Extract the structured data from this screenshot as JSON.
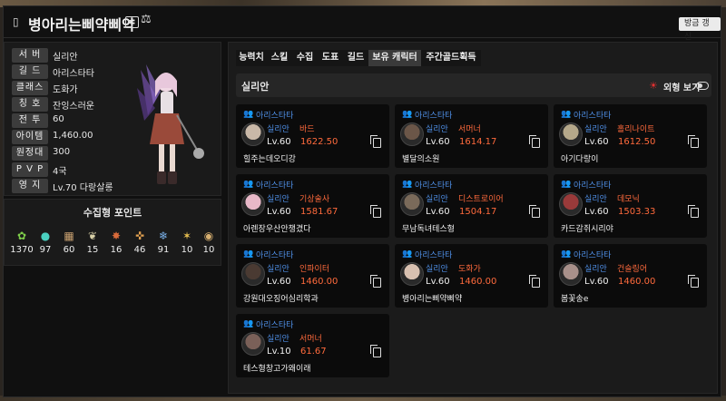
{
  "header": {
    "title": "병아리는삐약삐약",
    "refresh_label": "방금 갱신"
  },
  "profile": {
    "rows": [
      {
        "key": "서 버",
        "value": "실리안"
      },
      {
        "key": "길 드",
        "value": "아리스타타"
      },
      {
        "key": "클래스",
        "value": "도화가"
      },
      {
        "key": "칭 호",
        "value": "잔잉스러운"
      },
      {
        "key": "전 투",
        "value": "60"
      },
      {
        "key": "아이템",
        "value": "1,460.00"
      },
      {
        "key": "원정대",
        "value": "300"
      },
      {
        "key": "P V P",
        "value": "4국"
      },
      {
        "key": "영 지",
        "value": "Lv.70 다랑살롱"
      }
    ]
  },
  "collectibles": {
    "title": "수집형 포인트",
    "items": [
      {
        "icon": "mokoko-seed-icon",
        "value": "1370"
      },
      {
        "icon": "island-heart-icon",
        "value": "97"
      },
      {
        "icon": "great-art-icon",
        "value": "60"
      },
      {
        "icon": "giant-heart-icon",
        "value": "15"
      },
      {
        "icon": "ignea-token-icon",
        "value": "16"
      },
      {
        "icon": "sea-bounty-icon",
        "value": "46"
      },
      {
        "icon": "world-tree-leaf-icon",
        "value": "91"
      },
      {
        "icon": "orpheus-star-icon",
        "value": "10"
      },
      {
        "icon": "masterpiece-icon",
        "value": "10"
      }
    ]
  },
  "tabs": [
    {
      "label": "능력치"
    },
    {
      "label": "스킬"
    },
    {
      "label": "수집"
    },
    {
      "label": "도표"
    },
    {
      "label": "길드"
    },
    {
      "label": "보유 캐릭터"
    },
    {
      "label": "주간골드획득"
    }
  ],
  "active_tab": "보유 캐릭터",
  "roster": {
    "server": "실리안",
    "appearance_label": "외형 보기",
    "characters": [
      {
        "guild": "아리스타타",
        "server": "실리안",
        "class": "바드",
        "level": "Lv.60",
        "item_level": "1622.50",
        "name": "힐주는데오디강",
        "tone": "#c9b8a8"
      },
      {
        "guild": "아리스타타",
        "server": "실리안",
        "class": "서머너",
        "level": "Lv.60",
        "item_level": "1614.17",
        "name": "별달의소원",
        "tone": "#6b5648"
      },
      {
        "guild": "아리스타타",
        "server": "실리안",
        "class": "홀리나이트",
        "level": "Lv.60",
        "item_level": "1612.50",
        "name": "아기다랑이",
        "tone": "#b5a88a"
      },
      {
        "guild": "아리스타타",
        "server": "실리안",
        "class": "기상술사",
        "level": "Lv.60",
        "item_level": "1581.67",
        "name": "아렌장우산안챙겼다",
        "tone": "#e8b8c8"
      },
      {
        "guild": "아리스타타",
        "server": "실리안",
        "class": "디스트로이어",
        "level": "Lv.60",
        "item_level": "1504.17",
        "name": "무남독녀테스형",
        "tone": "#7a6a5a"
      },
      {
        "guild": "아리스타타",
        "server": "실리안",
        "class": "데모닉",
        "level": "Lv.60",
        "item_level": "1503.33",
        "name": "카드감쥐시리야",
        "tone": "#9a3a3a"
      },
      {
        "guild": "아리스타타",
        "server": "실리안",
        "class": "인파이터",
        "level": "Lv.60",
        "item_level": "1460.00",
        "name": "강원대오징어심리학과",
        "tone": "#4a3a32"
      },
      {
        "guild": "아리스타타",
        "server": "실리안",
        "class": "도화가",
        "level": "Lv.60",
        "item_level": "1460.00",
        "name": "병아리는삐약삐약",
        "tone": "#d8c0b0"
      },
      {
        "guild": "아리스타타",
        "server": "실리안",
        "class": "건슬링어",
        "level": "Lv.60",
        "item_level": "1460.00",
        "name": "봄꽃송e",
        "tone": "#a8908a"
      },
      {
        "guild": "아리스타타",
        "server": "실리안",
        "class": "서머너",
        "level": "Lv.10",
        "item_level": "61.67",
        "name": "테스형창고가왜이래",
        "tone": "#7a6058"
      }
    ]
  },
  "colors": {
    "accent_blue": "#4f8fe6",
    "accent_orange": "#ff6a3c",
    "panel_bg": "#1b1b1b",
    "card_bg": "#0b0b0b"
  }
}
